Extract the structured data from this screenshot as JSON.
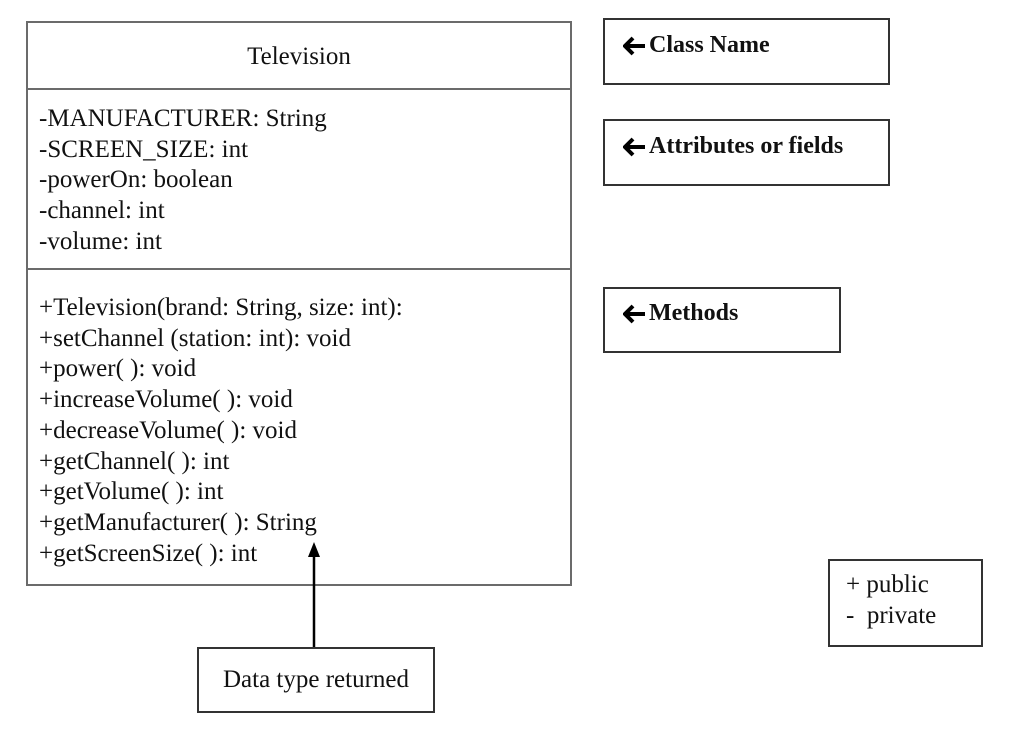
{
  "uml_class": {
    "name": "Television",
    "attributes": [
      "-MANUFACTURER: String",
      "-SCREEN_SIZE: int",
      "-powerOn: boolean",
      "-channel: int",
      "-volume: int"
    ],
    "methods": [
      "+Television(brand: String, size: int):",
      "+setChannel (station: int): void",
      "+power( ): void",
      "+increaseVolume( ): void",
      "+decreaseVolume( ): void",
      "+getChannel( ): int",
      "+getVolume( ): int",
      "+getManufacturer( ): String",
      "+getScreenSize( ): int"
    ]
  },
  "annotations": {
    "class_name": "Class Name",
    "attributes": "Attributes or fields",
    "methods": "Methods",
    "arrow_icon": "left-arrow-icon"
  },
  "legend": {
    "public": "+ public",
    "private": "-  private"
  },
  "callout": {
    "text": "Data type returned",
    "arrow_icon": "up-arrow-icon"
  }
}
